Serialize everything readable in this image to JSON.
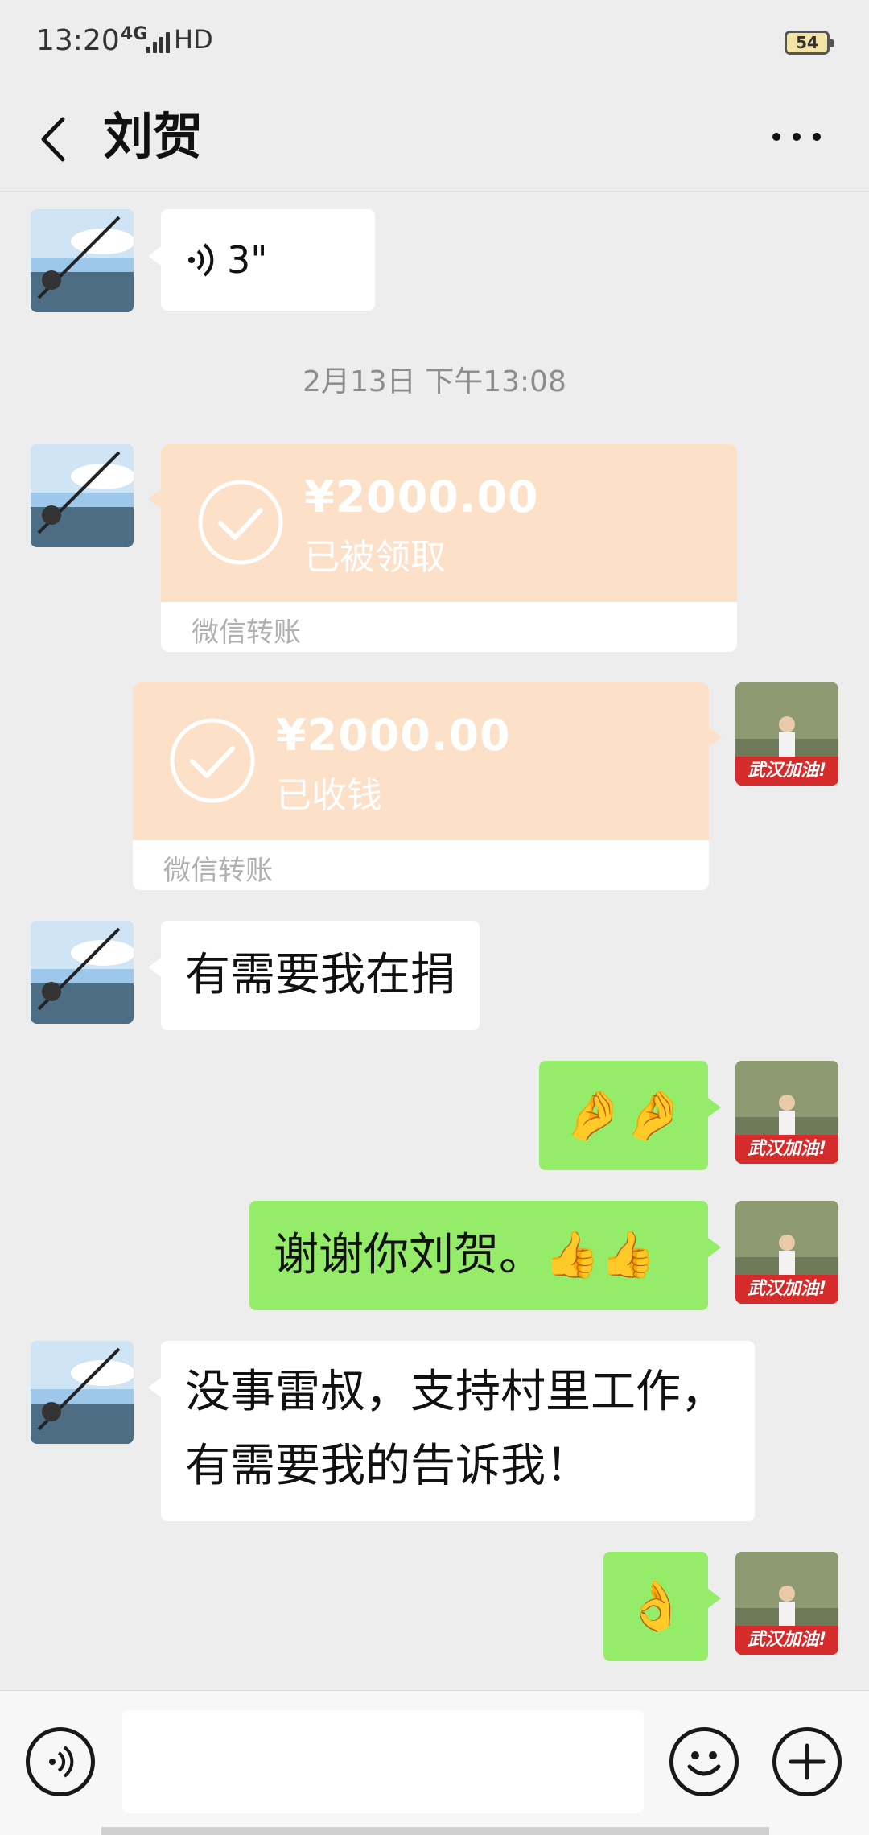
{
  "status_bar": {
    "time": "13:20",
    "network": "4G",
    "hd": "HD",
    "battery": "54"
  },
  "header": {
    "title": "刘贺",
    "back_icon": "chevron-left-icon",
    "more_icon": "more-dots-icon"
  },
  "messages": {
    "voice": {
      "duration": "3\""
    },
    "timestamp": "2月13日 下午13:08",
    "transfer_received_by_other": {
      "amount": "¥2000.00",
      "status": "已被领取",
      "label": "微信转账"
    },
    "transfer_collected": {
      "amount": "¥2000.00",
      "status": "已收钱",
      "label": "微信转账"
    },
    "text_1": "有需要我在捐",
    "emoji_1": "🤌🤌",
    "text_2": "谢谢你刘贺。",
    "text_2_emoji": "👍👍",
    "text_3_line1": "没事雷叔，支持村里工作，",
    "text_3_line2": "有需要我的告诉我！",
    "emoji_2": "👌"
  },
  "avatar_badge": "武汉加油!",
  "input_bar": {
    "placeholder": "",
    "voice_icon": "voice-icon",
    "emoji_icon": "smiley-icon",
    "add_icon": "plus-icon"
  },
  "colors": {
    "background": "#ededed",
    "bubble_green": "#95ec69",
    "transfer_bg": "#fde0c8"
  }
}
